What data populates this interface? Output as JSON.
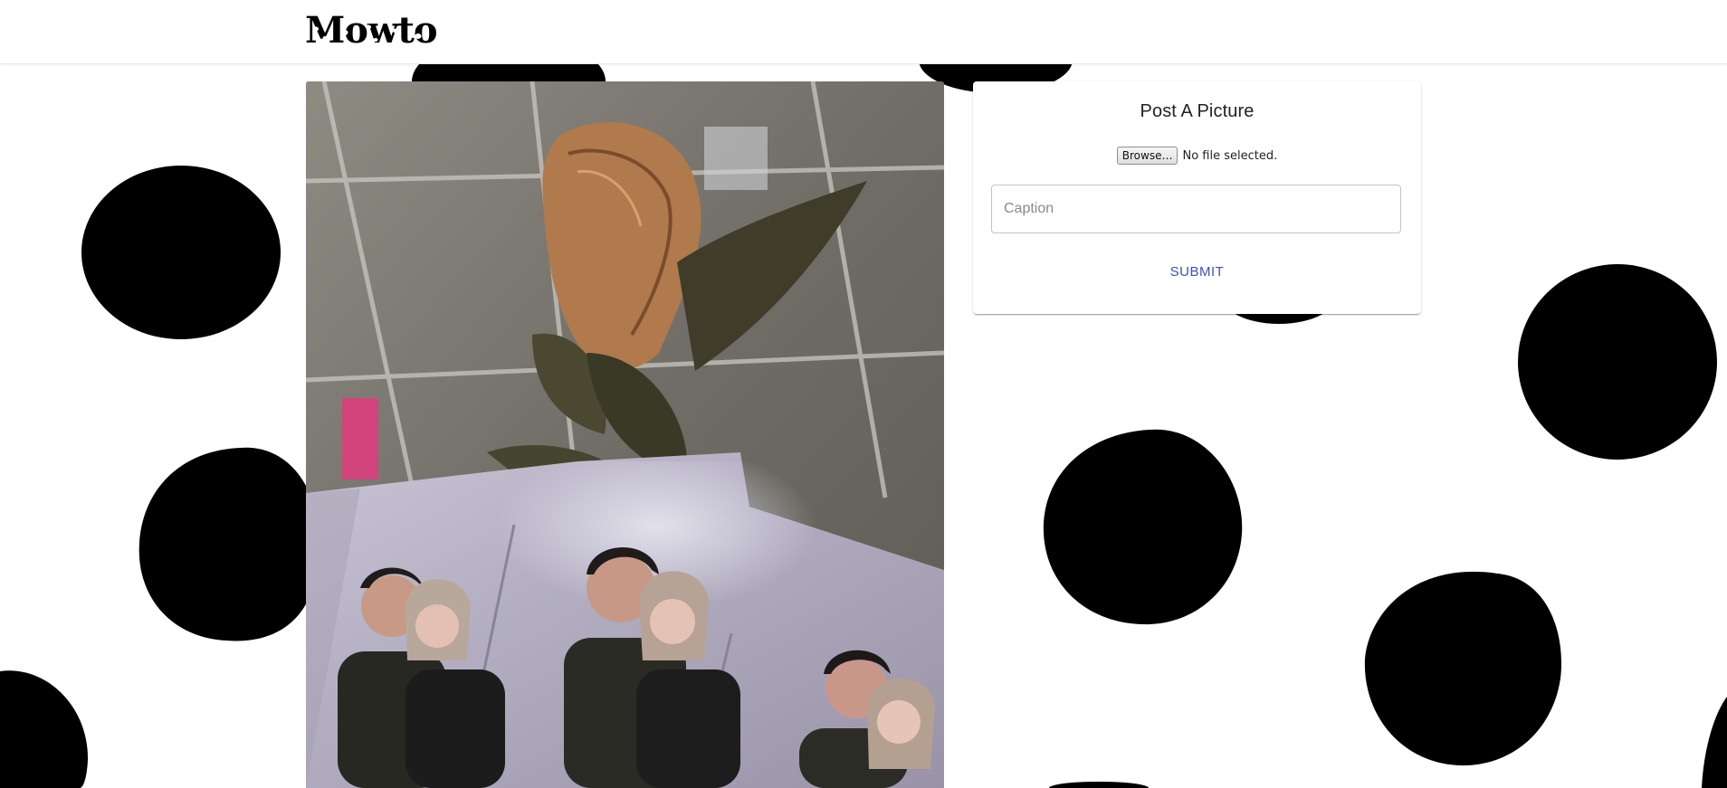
{
  "app": {
    "logo_text": "Mowto"
  },
  "post_form": {
    "title": "Post A Picture",
    "browse_label": "Browse…",
    "file_status": "No file selected.",
    "caption_placeholder": "Caption",
    "caption_value": "",
    "submit_label": "SUBMIT"
  },
  "colors": {
    "background": "#ffffff",
    "blob": "#000000",
    "accent": "#3f51b5"
  },
  "icons": {
    "logo": "cow-spotted-logo"
  }
}
